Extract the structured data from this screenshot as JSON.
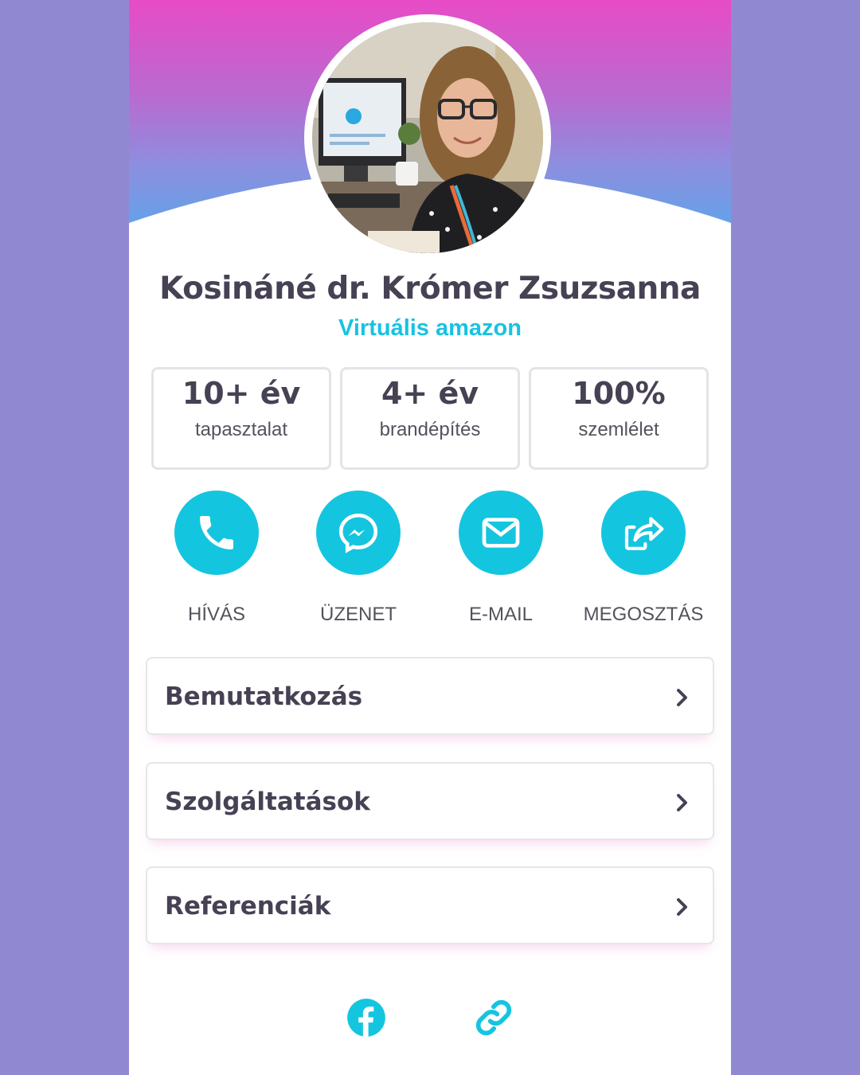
{
  "profile": {
    "name": "Kosináné dr. Krómer Zsuzsanna",
    "subtitle": "Virtuális amazon"
  },
  "stats": [
    {
      "value": "10+ év",
      "label": "tapasztalat"
    },
    {
      "value": "4+ év",
      "label": "brandépítés"
    },
    {
      "value": "100%",
      "label": "szemlélet"
    }
  ],
  "actions": [
    {
      "label": "HÍVÁS",
      "icon": "phone-icon"
    },
    {
      "label": "ÜZENET",
      "icon": "messenger-icon"
    },
    {
      "label": "E-MAIL",
      "icon": "envelope-icon"
    },
    {
      "label": "MEGOSZTÁS",
      "icon": "share-icon"
    }
  ],
  "menu": [
    {
      "label": "Bemutatkozás"
    },
    {
      "label": "Szolgáltatások"
    },
    {
      "label": "Referenciák"
    }
  ],
  "social": [
    {
      "icon": "facebook-icon"
    },
    {
      "icon": "link-icon"
    }
  ],
  "colors": {
    "page_background": "#9089d2",
    "accent": "#14c5e0",
    "text_dark": "#474154",
    "gradient_top": "#e84bc6",
    "gradient_bottom": "#5aa6ec"
  }
}
